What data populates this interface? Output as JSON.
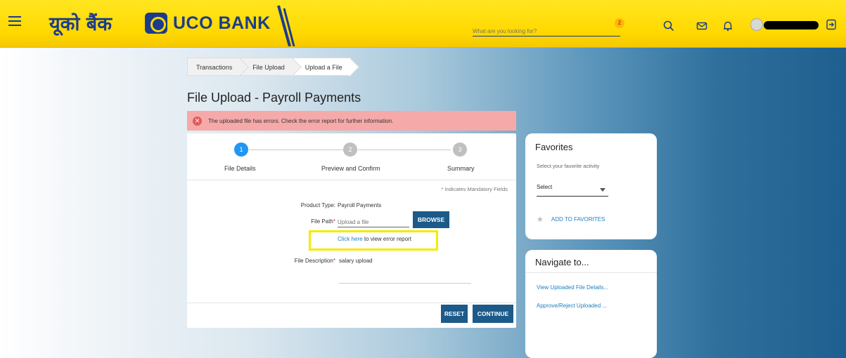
{
  "header": {
    "logo_hindi": "यूको बैंक",
    "logo_text": "UCO BANK",
    "search_placeholder": "What are you looking for?",
    "badge_count": "2",
    "brand_color": "#1b3c8c",
    "header_color": "#ffd800"
  },
  "breadcrumb": [
    "Transactions",
    "File Upload",
    "Upload a File"
  ],
  "page_title": "File Upload - Payroll Payments",
  "alert": {
    "icon": "error-icon",
    "text": "The uploaded file has errors. Check the error report for further information."
  },
  "stepper": [
    {
      "number": "1",
      "label": "File Details",
      "active": true
    },
    {
      "number": "2",
      "label": "Preview and Confirm",
      "active": false
    },
    {
      "number": "3",
      "label": "Summary",
      "active": false
    }
  ],
  "form": {
    "mandatory_note": "* Indicates Mandatory Fields",
    "product_type_label": "Product Type:",
    "product_type_value": "Payroll Payments",
    "file_path_label": "File Path",
    "file_path_placeholder": "Upload a file",
    "browse_label": "BROWSE",
    "error_link_text": "Click here",
    "error_link_suffix": "to view error report",
    "description_label": "File Description",
    "description_value": "salary upload",
    "reset_label": "RESET",
    "continue_label": "CONTINUE"
  },
  "favorites": {
    "title": "Favorites",
    "subtitle": "Select your favorite activity",
    "select_value": "Select",
    "add_label": "ADD TO FAVORITES"
  },
  "navigate": {
    "title": "Navigate to...",
    "links": [
      "View Uploaded File Details...",
      "Approve/Reject Uploaded ..."
    ]
  }
}
